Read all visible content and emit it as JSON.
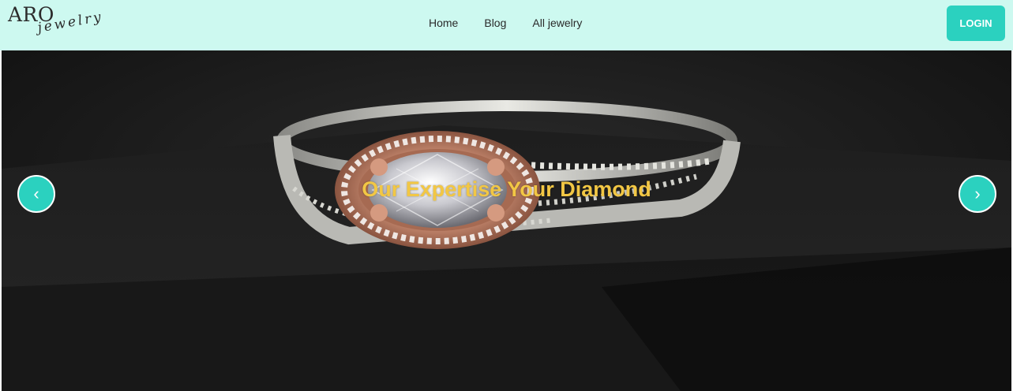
{
  "brand": {
    "name": "ARO",
    "tagline": "jewelry"
  },
  "nav": {
    "links": [
      "Home",
      "Blog",
      "All jewelry"
    ],
    "login_label": "LOGIN"
  },
  "hero": {
    "headline": "Our Expertise Your Diamond",
    "image_alt": "Rose gold halo engagement ring with oval diamond on black display box",
    "prev_icon": "‹",
    "next_icon": "›"
  },
  "colors": {
    "navbar_bg": "#cdf9f0",
    "accent": "#2bd1bf",
    "headline": "#f2c744",
    "hero_bg": "#141414"
  }
}
